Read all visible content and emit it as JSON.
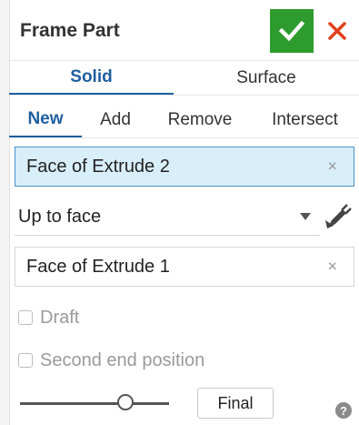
{
  "dialog": {
    "title": "Frame Part",
    "ok_color": "#2e9b2e",
    "cancel_color": "#e0401a",
    "accent_color": "#1f5f9f"
  },
  "body_type_tabs": [
    {
      "label": "Solid",
      "active": true
    },
    {
      "label": "Surface",
      "active": false
    }
  ],
  "operation_tabs": [
    {
      "label": "New",
      "active": true
    },
    {
      "label": "Add",
      "active": false
    },
    {
      "label": "Remove",
      "active": false
    },
    {
      "label": "Intersect",
      "active": false
    }
  ],
  "faces_query": {
    "value": "Face of Extrude 2",
    "clear_icon": "×"
  },
  "end_type": {
    "value": "Up to face"
  },
  "up_to_face_query": {
    "value": "Face of Extrude 1",
    "clear_icon": "×"
  },
  "options": {
    "draft": {
      "label": "Draft",
      "checked": false
    },
    "second_end": {
      "label": "Second end position",
      "checked": false
    }
  },
  "rollback": {
    "slider_fraction": 0.73,
    "final_label": "Final"
  },
  "help": {
    "glyph": "?"
  }
}
